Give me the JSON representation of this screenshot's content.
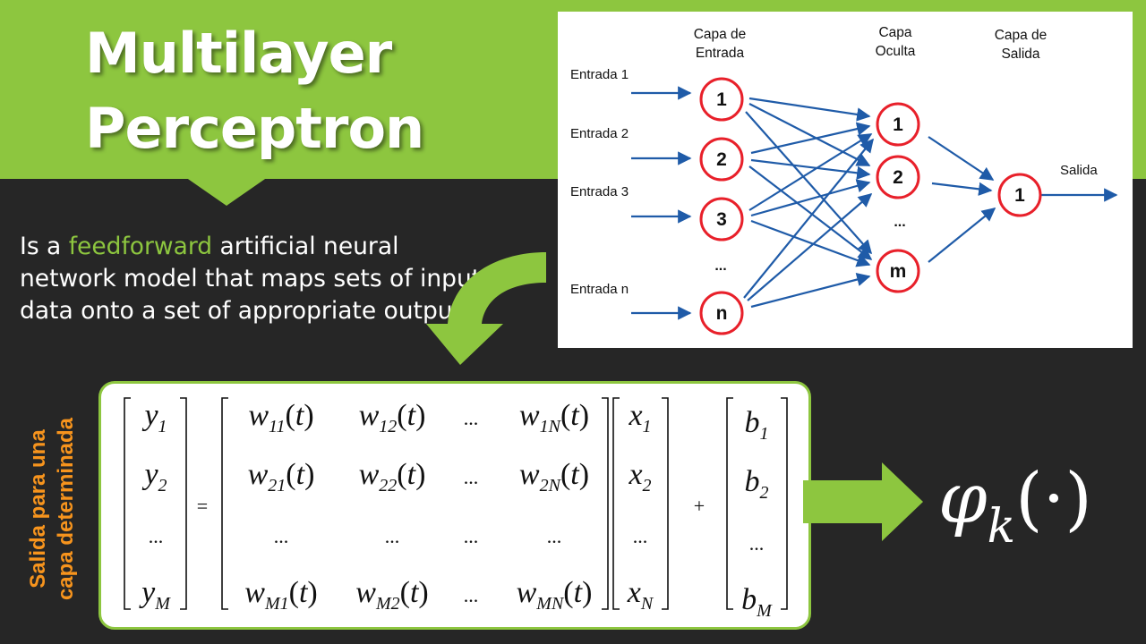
{
  "slide": {
    "title_line1": "Multilayer",
    "title_line2": "Perceptron",
    "description": {
      "before": "Is a ",
      "highlight": "feedforward",
      "after": " artificial neural network model that maps sets of input data onto a set of appropriate outputs."
    },
    "side_label_line1": "Salida para una",
    "side_label_line2": "capa determinada",
    "activation": {
      "symbol": "φ",
      "subscript": "k",
      "argument": "(·)"
    }
  },
  "diagram": {
    "headers": {
      "input_1": "Capa de",
      "input_2": "Entrada",
      "hidden_1": "Capa",
      "hidden_2": "Oculta",
      "output_1": "Capa de",
      "output_2": "Salida"
    },
    "inputs": [
      "Entrada 1",
      "Entrada 2",
      "Entrada 3",
      "Entrada n"
    ],
    "input_nodes": [
      "1",
      "2",
      "3",
      "n"
    ],
    "hidden_nodes": [
      "1",
      "2",
      "m"
    ],
    "output_nodes": [
      "1"
    ],
    "ellipsis": "...",
    "output_label": "Salida"
  },
  "equation": {
    "y": [
      [
        "y",
        "1"
      ],
      [
        "y",
        "2"
      ],
      [
        "...",
        ""
      ],
      [
        "y",
        "M"
      ]
    ],
    "equals": "=",
    "plus": "+",
    "w": [
      [
        [
          "w",
          "11",
          "(t)"
        ],
        [
          "w",
          "12",
          "(t)"
        ],
        [
          "...",
          "",
          ""
        ],
        [
          "w",
          "1N",
          "(t)"
        ]
      ],
      [
        [
          "w",
          "21",
          "(t)"
        ],
        [
          "w",
          "22",
          "(t)"
        ],
        [
          "...",
          "",
          ""
        ],
        [
          "w",
          "2N",
          "(t)"
        ]
      ],
      [
        [
          "...",
          "",
          ""
        ],
        [
          "...",
          "",
          ""
        ],
        [
          "...",
          "",
          ""
        ],
        [
          "...",
          "",
          ""
        ]
      ],
      [
        [
          "w",
          "M1",
          "(t)"
        ],
        [
          "w",
          "M2",
          "(t)"
        ],
        [
          "...",
          "",
          ""
        ],
        [
          "w",
          "MN",
          "(t)"
        ]
      ]
    ],
    "x": [
      [
        "x",
        "1"
      ],
      [
        "x",
        "2"
      ],
      [
        "...",
        ""
      ],
      [
        "x",
        "N"
      ]
    ],
    "b": [
      [
        "b",
        "1"
      ],
      [
        "b",
        "2"
      ],
      [
        "...",
        ""
      ],
      [
        "b",
        "M"
      ]
    ]
  },
  "colors": {
    "accent": "#8dc63f",
    "background": "#262626",
    "side_label": "#f7941d",
    "node_border": "#e8202a",
    "edge": "#1f5ba8"
  }
}
